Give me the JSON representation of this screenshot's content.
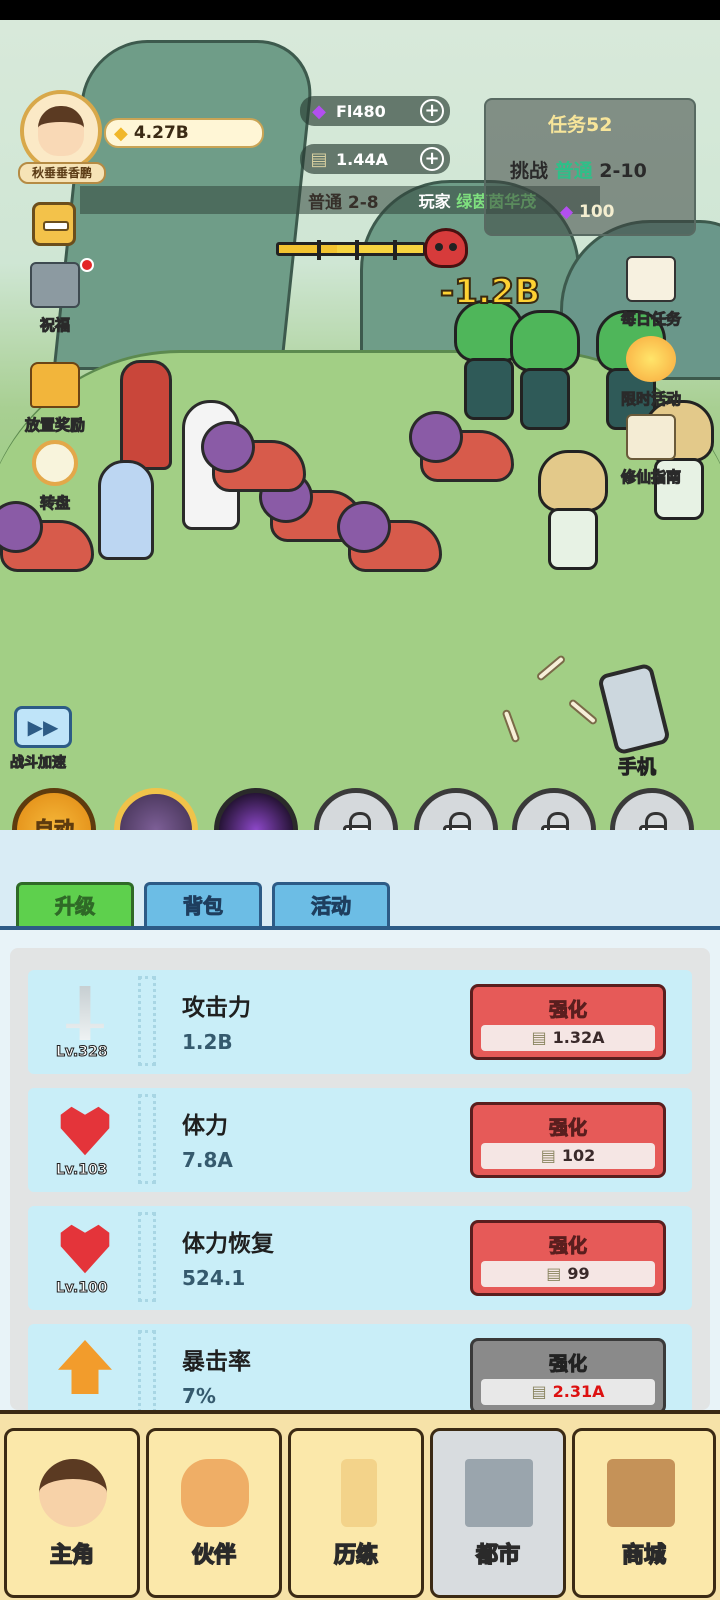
{
  "player": {
    "name": "秋垂垂香鹏",
    "gold": "4.27B"
  },
  "resources": {
    "gems": "Fl480",
    "cash": "1.44A"
  },
  "stage": {
    "label": "普通 2-8"
  },
  "ticker": {
    "prefix": "玩家",
    "name": "绿茵茵华茂"
  },
  "mission": {
    "title": "任务52",
    "challenge_prefix": "挑战",
    "challenge_mode": "普通",
    "challenge_stage": "2-10",
    "reward": "100"
  },
  "battle": {
    "damage_text": "-1.2B",
    "boss_hp_fraction": 0.4
  },
  "side_left": [
    {
      "label": "祝福",
      "icon": "blessing-icon"
    },
    {
      "label": "放置奖励",
      "icon": "treasure-chest-icon"
    },
    {
      "label": "转盘",
      "icon": "wheel-icon"
    }
  ],
  "side_right": [
    {
      "label": "每日任务",
      "icon": "daily-tasks-icon"
    },
    {
      "label": "限时活动",
      "icon": "event-icon"
    },
    {
      "label": "修仙指南",
      "icon": "guide-icon"
    }
  ],
  "speed_label": "战斗加速",
  "phone_label": "手机",
  "skills": {
    "auto_label": "自动"
  },
  "tabs": [
    "升级",
    "背包",
    "活动"
  ],
  "upgrades": [
    {
      "name": "攻击力",
      "value": "1.2B",
      "level": "Lv.328",
      "button": "强化",
      "cost": "1.32A",
      "icon": "sword-icon",
      "enabled": true
    },
    {
      "name": "体力",
      "value": "7.8A",
      "level": "Lv.103",
      "button": "强化",
      "cost": "102",
      "icon": "heart-icon",
      "enabled": true
    },
    {
      "name": "体力恢复",
      "value": "524.1",
      "level": "Lv.100",
      "button": "强化",
      "cost": "99",
      "icon": "heart-plus-icon",
      "enabled": true
    },
    {
      "name": "暴击率",
      "value": "7%",
      "level": "",
      "button": "强化",
      "cost": "2.31A",
      "icon": "crit-arrow-icon",
      "enabled": false
    }
  ],
  "nav": [
    "主角",
    "伙伴",
    "历练",
    "都市",
    "商城"
  ],
  "colors": {
    "tab_active": "#5ed04d",
    "tab_inactive": "#6cbde5",
    "upgrade_button": "#e65a58",
    "damage_text": "#ffd233"
  }
}
